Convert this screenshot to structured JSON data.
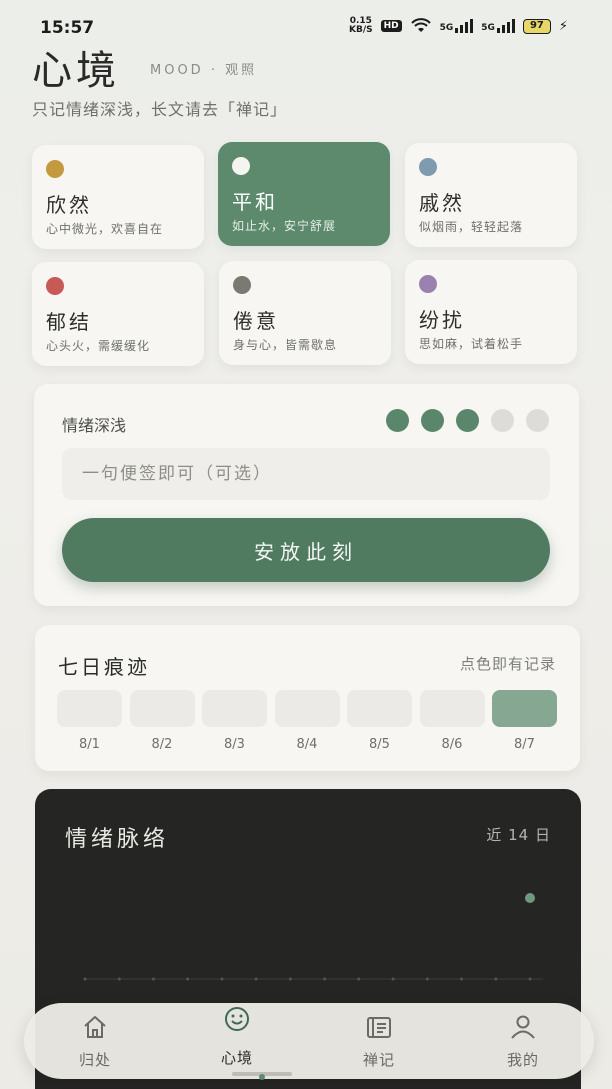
{
  "status_bar": {
    "time": "15:57",
    "net_speed_value": "0.15",
    "net_speed_unit": "KB/S",
    "hd": "HD",
    "sig1": "5G",
    "sig2": "5G",
    "battery": "97"
  },
  "header": {
    "title": "心境",
    "subtitle": "MOOD · 观照",
    "tagline": "只记情绪深浅，长文请去「禅记」"
  },
  "moods": [
    {
      "name": "欣然",
      "desc": "心中微光，欢喜自在",
      "color": "#c49a3f",
      "active": false
    },
    {
      "name": "平和",
      "desc": "如止水，安宁舒展",
      "color": "#f4f4f0",
      "active": true
    },
    {
      "name": "戚然",
      "desc": "似烟雨，轻轻起落",
      "color": "#7f9bb0",
      "active": false
    },
    {
      "name": "郁结",
      "desc": "心头火，需缓缓化",
      "color": "#c75a55",
      "active": false
    },
    {
      "name": "倦意",
      "desc": "身与心，皆需歇息",
      "color": "#7a7a72",
      "active": false
    },
    {
      "name": "纷扰",
      "desc": "思如麻，试着松手",
      "color": "#9a82b0",
      "active": false
    }
  ],
  "intensity": {
    "label": "情绪深浅",
    "level": 3,
    "max": 5,
    "placeholder": "一句便签即可（可选）",
    "save_label": "安放此刻",
    "on_color": "#5a876b",
    "off_color": "#dedcd8"
  },
  "week": {
    "title": "七日痕迹",
    "hint": "点色即有记录",
    "days": [
      {
        "label": "8/1",
        "filled": false
      },
      {
        "label": "8/2",
        "filled": false
      },
      {
        "label": "8/3",
        "filled": false
      },
      {
        "label": "8/4",
        "filled": false
      },
      {
        "label": "8/5",
        "filled": false
      },
      {
        "label": "8/6",
        "filled": false
      },
      {
        "label": "8/7",
        "filled": true
      }
    ]
  },
  "pulse": {
    "title": "情绪脉络",
    "range": "近 14 日"
  },
  "chart_data": {
    "type": "scatter",
    "title": "情绪脉络",
    "subtitle": "近 14 日",
    "x": [
      1,
      2,
      3,
      4,
      5,
      6,
      7,
      8,
      9,
      10,
      11,
      12,
      13,
      14
    ],
    "values": [
      null,
      null,
      null,
      null,
      null,
      null,
      null,
      null,
      null,
      null,
      null,
      null,
      null,
      3
    ],
    "ylim": [
      0,
      5
    ],
    "grid": false,
    "point_color": "#6e9b7d"
  },
  "nav": {
    "items": [
      {
        "label": "归处",
        "icon": "home-icon",
        "active": false
      },
      {
        "label": "心境",
        "icon": "smile-icon",
        "active": true
      },
      {
        "label": "禅记",
        "icon": "journal-icon",
        "active": false
      },
      {
        "label": "我的",
        "icon": "user-icon",
        "active": false
      }
    ]
  }
}
